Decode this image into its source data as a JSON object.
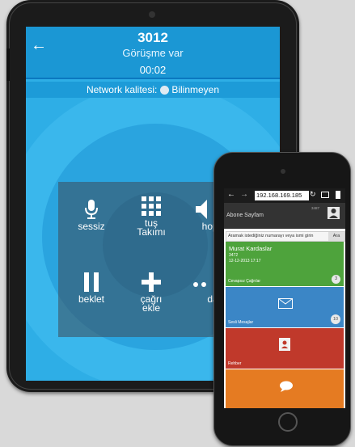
{
  "tablet": {
    "number": "3012",
    "status": "Görüşme var",
    "timer": "00:02",
    "network_label": "Network kalitesi:",
    "network_value": "Bilinmeyen",
    "buttons": {
      "mute": "sessiz",
      "keypad_1": "tuş",
      "keypad_2": "Takımı",
      "speaker": "hopa",
      "hold": "beklet",
      "add_1": "çağrı",
      "add_2": "ekle",
      "more": "da"
    }
  },
  "phone": {
    "url": "192.168.169.185",
    "header_title": "Abone Sayfam",
    "header_number": "3487",
    "search_placeholder": "Aramak istediğiniz numarayı veya ismi girin",
    "search_button": "Ara",
    "missed": {
      "name": "Murat Kardaslar",
      "number": "3472",
      "datetime": "12-12-2013 17:17",
      "label": "Cevapsız Çağrılar",
      "count": "3"
    },
    "voicemail": {
      "label": "Sesli Mesajlar",
      "count": "10"
    },
    "contacts": {
      "label": "Rehber"
    }
  },
  "colors": {
    "tablet_bg": "#2eaee6",
    "green": "#4ea33c",
    "blue": "#3b86c6",
    "red": "#c0392b",
    "orange": "#e57b22"
  }
}
